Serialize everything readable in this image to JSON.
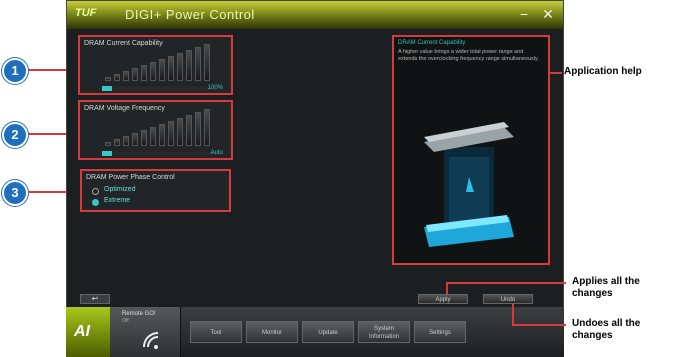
{
  "window": {
    "title": "DIGI+ Power Control",
    "logo_text": "TUF",
    "minimize": "−",
    "close": "✕"
  },
  "panels": [
    {
      "title": "DRAM Current Capability",
      "value": "100%",
      "level": 1.0
    },
    {
      "title": "DRAM Voltage Frequency",
      "value": "Auto",
      "level": 0.8
    }
  ],
  "phase": {
    "title": "DRAM Power Phase Control",
    "options": [
      {
        "label": "Optimized",
        "selected": false
      },
      {
        "label": "Extreme",
        "selected": true
      }
    ]
  },
  "help": {
    "title": "DRAM Current Capability",
    "text": "A higher value brings a wider total power range and extends the overclocking frequency range simultaneously."
  },
  "buttons": {
    "apply": "Apply",
    "undo": "Undo",
    "back": "↩"
  },
  "footer": {
    "ai_label": "AI",
    "remote_label": "Remote GO!",
    "remote_sub": "Off",
    "nav": [
      "Tool",
      "Monitor",
      "Update",
      "System Information",
      "Settings"
    ]
  },
  "callouts": {
    "markers": [
      "1",
      "2",
      "3"
    ],
    "app_help": "Application help",
    "applies": [
      "Applies all the",
      "changes"
    ],
    "undoes": [
      "Undoes all the",
      "changes"
    ]
  }
}
